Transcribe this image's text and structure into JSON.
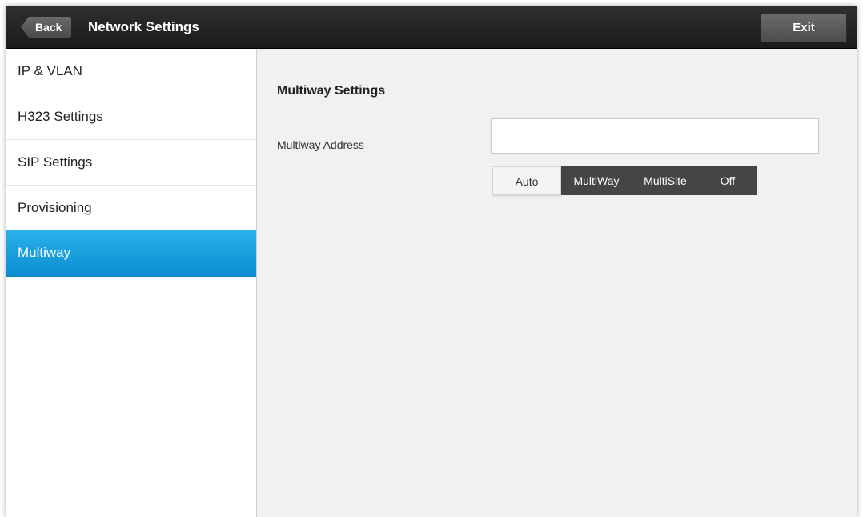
{
  "header": {
    "back_label": "Back",
    "title": "Network Settings",
    "exit_label": "Exit"
  },
  "sidebar": {
    "items": [
      {
        "label": "IP & VLAN"
      },
      {
        "label": "H323 Settings"
      },
      {
        "label": "SIP Settings"
      },
      {
        "label": "Provisioning"
      },
      {
        "label": "Multiway"
      }
    ],
    "active_index": 4
  },
  "main": {
    "section_title": "Multiway Settings",
    "address_label": "Multiway Address",
    "address_value": "",
    "protocol_options": [
      "Auto",
      "MultiWay",
      "MultiSite",
      "Off"
    ],
    "protocol_selected": "Auto"
  },
  "colors": {
    "accent": "#1aa0df",
    "topbar": "#232323",
    "segmented_bg": "#454545"
  }
}
